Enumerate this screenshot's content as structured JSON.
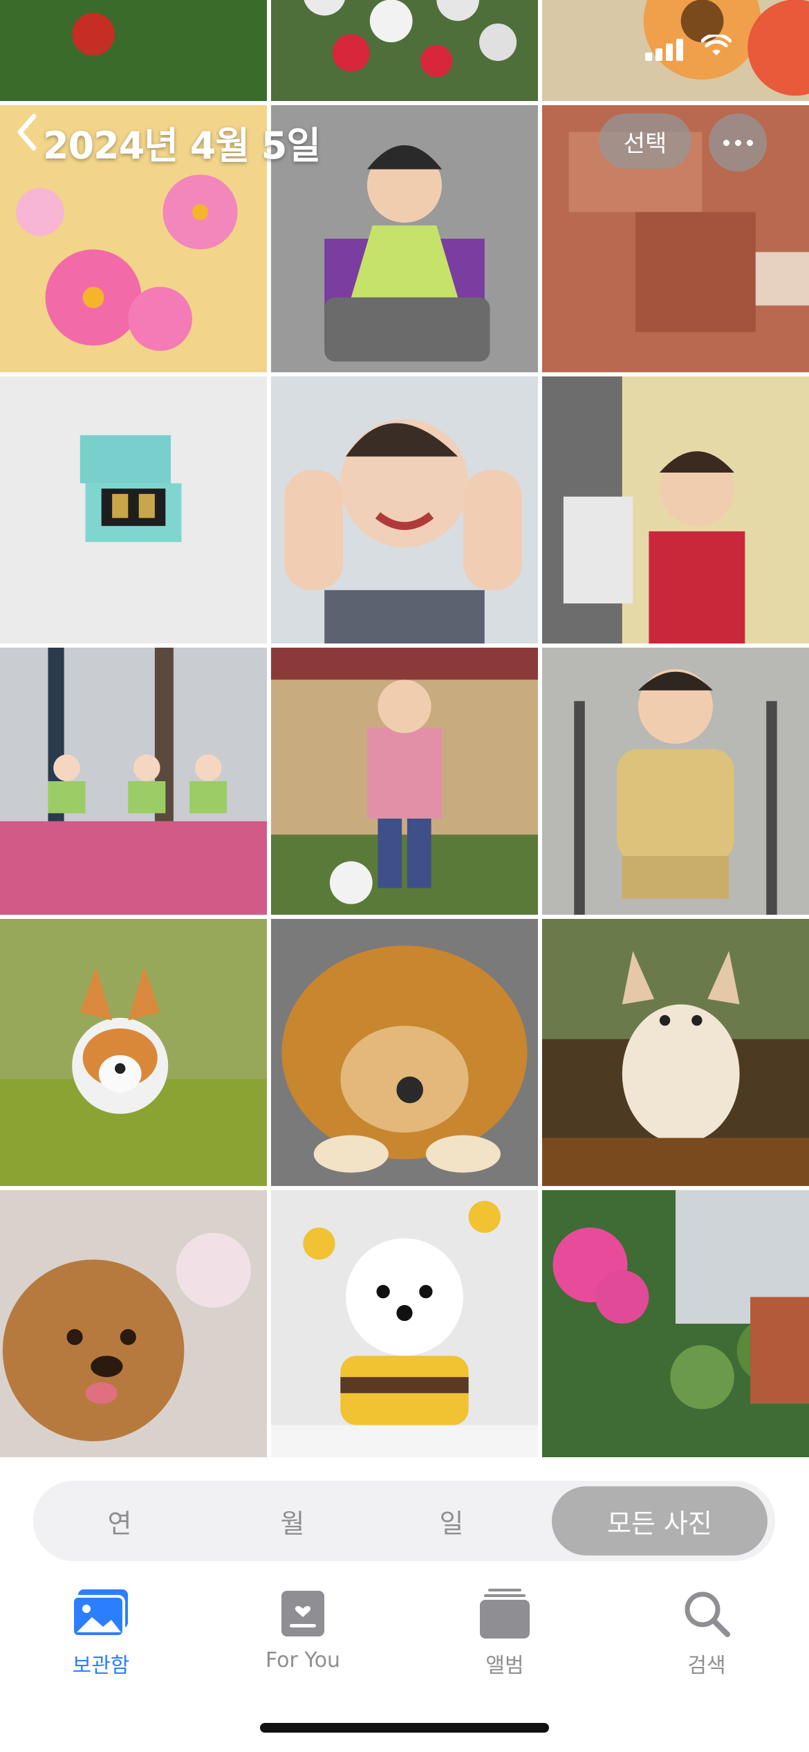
{
  "status_bar": {
    "signal_icon": "cellular-signal-icon",
    "wifi_icon": "wifi-icon"
  },
  "header": {
    "title": "2024년 4월 5일",
    "back_icon": "chevron-left-icon",
    "select_label": "선택",
    "more_icon": "ellipsis-icon"
  },
  "photos": [
    {
      "subject": "red tulips"
    },
    {
      "subject": "white tulips"
    },
    {
      "subject": "gerbera flowers"
    },
    {
      "subject": "pink cosmos"
    },
    {
      "subject": "child with bib at lunch"
    },
    {
      "subject": "child at table"
    },
    {
      "subject": "ring box"
    },
    {
      "subject": "smiling girl hands"
    },
    {
      "subject": "child in red sweater"
    },
    {
      "subject": "kindergarten walk"
    },
    {
      "subject": "girl in pink jacket"
    },
    {
      "subject": "child on swing"
    },
    {
      "subject": "corgi on grass"
    },
    {
      "subject": "pomeranian"
    },
    {
      "subject": "running puppy"
    },
    {
      "subject": "poodle with blossoms"
    },
    {
      "subject": "bichon in bee costume"
    },
    {
      "subject": "pink geranium"
    }
  ],
  "segments": {
    "year": "연",
    "month": "월",
    "day": "일",
    "all": "모든 사진"
  },
  "tabs": {
    "library": {
      "label": "보관함",
      "icon": "photo-library-icon"
    },
    "for_you": {
      "label": "For You",
      "icon": "for-you-icon"
    },
    "albums": {
      "label": "앨범",
      "icon": "albums-icon"
    },
    "search": {
      "label": "검색",
      "icon": "search-icon"
    }
  },
  "colors": {
    "accent": "#2b7fff",
    "inactive": "#8e8e93"
  }
}
